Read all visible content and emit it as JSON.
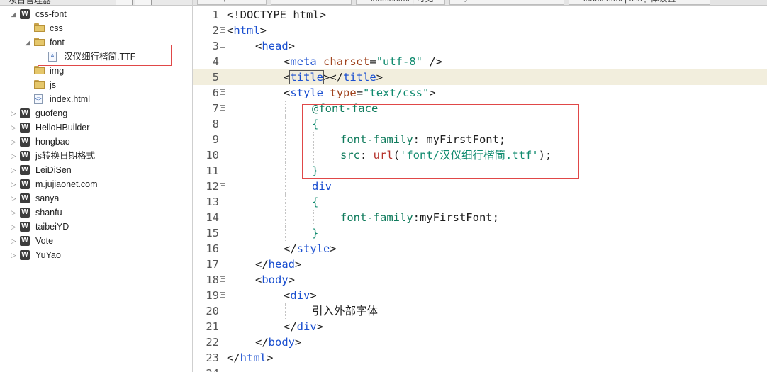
{
  "sidebar": {
    "title": "项目管理器",
    "tree": [
      {
        "depth": 0,
        "expanded": true,
        "icon": "project-icon",
        "label": "css-font"
      },
      {
        "depth": 1,
        "expanded": null,
        "icon": "folder-icon",
        "label": "css"
      },
      {
        "depth": 1,
        "expanded": true,
        "icon": "folder-icon",
        "label": "font"
      },
      {
        "depth": 2,
        "expanded": null,
        "icon": "font-file-icon",
        "label": "汉仪细行楷简.TTF"
      },
      {
        "depth": 1,
        "expanded": null,
        "icon": "folder-icon",
        "label": "img"
      },
      {
        "depth": 1,
        "expanded": null,
        "icon": "folder-icon",
        "label": "js"
      },
      {
        "depth": 1,
        "expanded": null,
        "icon": "html-file-icon",
        "label": "index.html"
      },
      {
        "depth": 0,
        "expanded": false,
        "icon": "project-icon",
        "label": "guofeng"
      },
      {
        "depth": 0,
        "expanded": false,
        "icon": "project-icon",
        "label": "HelloHBuilder"
      },
      {
        "depth": 0,
        "expanded": false,
        "icon": "project-icon",
        "label": "hongbao"
      },
      {
        "depth": 0,
        "expanded": false,
        "icon": "project-icon",
        "label": "js转换日期格式"
      },
      {
        "depth": 0,
        "expanded": false,
        "icon": "project-icon",
        "label": "LeiDiSen"
      },
      {
        "depth": 0,
        "expanded": false,
        "icon": "project-icon",
        "label": "m.jujiaonet.com"
      },
      {
        "depth": 0,
        "expanded": false,
        "icon": "project-icon",
        "label": "sanya"
      },
      {
        "depth": 0,
        "expanded": false,
        "icon": "project-icon",
        "label": "shanfu"
      },
      {
        "depth": 0,
        "expanded": false,
        "icon": "project-icon",
        "label": "taibeiYD"
      },
      {
        "depth": 0,
        "expanded": false,
        "icon": "project-icon",
        "label": "Vote"
      },
      {
        "depth": 0,
        "expanded": false,
        "icon": "project-icon",
        "label": "YuYao"
      }
    ]
  },
  "tabs": [
    "map.html",
    "index.css",
    "index.html | 可见",
    "yuanshemeishi.html",
    "index.html | css字体设置"
  ],
  "editor": {
    "current_line": 5,
    "lines": [
      {
        "n": 1,
        "fold": false,
        "indent": 0,
        "tokens": [
          [
            "punc",
            "<!DOCTYPE html>"
          ]
        ]
      },
      {
        "n": 2,
        "fold": true,
        "indent": 0,
        "tokens": [
          [
            "punc",
            "<"
          ],
          [
            "tag",
            "html"
          ],
          [
            "punc",
            ">"
          ]
        ]
      },
      {
        "n": 3,
        "fold": true,
        "indent": 1,
        "tokens": [
          [
            "punc",
            "<"
          ],
          [
            "tag",
            "head"
          ],
          [
            "punc",
            ">"
          ]
        ]
      },
      {
        "n": 4,
        "fold": false,
        "indent": 2,
        "tokens": [
          [
            "punc",
            "<"
          ],
          [
            "tag",
            "meta"
          ],
          [
            "text",
            " "
          ],
          [
            "attr",
            "charset"
          ],
          [
            "punc",
            "="
          ],
          [
            "str",
            "\"utf-8\""
          ],
          [
            "punc",
            " />"
          ]
        ]
      },
      {
        "n": 5,
        "fold": false,
        "indent": 2,
        "tokens": [
          [
            "punc",
            "<"
          ],
          [
            "tag",
            "title"
          ],
          [
            "punc",
            "></"
          ],
          [
            "tag",
            "title"
          ],
          [
            "punc",
            ">"
          ]
        ]
      },
      {
        "n": 6,
        "fold": true,
        "indent": 2,
        "tokens": [
          [
            "punc",
            "<"
          ],
          [
            "tag",
            "style"
          ],
          [
            "text",
            " "
          ],
          [
            "attr",
            "type"
          ],
          [
            "punc",
            "="
          ],
          [
            "str",
            "\"text/css\""
          ],
          [
            "punc",
            ">"
          ]
        ]
      },
      {
        "n": 7,
        "fold": true,
        "indent": 3,
        "tokens": [
          [
            "at",
            "@font-face"
          ]
        ]
      },
      {
        "n": 8,
        "fold": false,
        "indent": 3,
        "tokens": [
          [
            "str",
            "{"
          ]
        ]
      },
      {
        "n": 9,
        "fold": false,
        "indent": 4,
        "tokens": [
          [
            "prop",
            "font-family"
          ],
          [
            "text",
            ": myFirstFont;"
          ]
        ]
      },
      {
        "n": 10,
        "fold": false,
        "indent": 4,
        "tokens": [
          [
            "prop",
            "src"
          ],
          [
            "text",
            ": "
          ],
          [
            "url",
            "url"
          ],
          [
            "text",
            "("
          ],
          [
            "str",
            "'font/汉仪细行楷简.ttf'"
          ],
          [
            "text",
            ");"
          ]
        ]
      },
      {
        "n": 11,
        "fold": false,
        "indent": 3,
        "tokens": [
          [
            "str",
            "}"
          ]
        ]
      },
      {
        "n": 12,
        "fold": true,
        "indent": 3,
        "tokens": [
          [
            "tag",
            "div"
          ]
        ]
      },
      {
        "n": 13,
        "fold": false,
        "indent": 3,
        "tokens": [
          [
            "str",
            "{"
          ]
        ]
      },
      {
        "n": 14,
        "fold": false,
        "indent": 4,
        "tokens": [
          [
            "prop",
            "font-family"
          ],
          [
            "text",
            ":myFirstFont;"
          ]
        ]
      },
      {
        "n": 15,
        "fold": false,
        "indent": 3,
        "tokens": [
          [
            "str",
            "}"
          ]
        ]
      },
      {
        "n": 16,
        "fold": false,
        "indent": 2,
        "tokens": [
          [
            "punc",
            "</"
          ],
          [
            "tag",
            "style"
          ],
          [
            "punc",
            ">"
          ]
        ]
      },
      {
        "n": 17,
        "fold": false,
        "indent": 1,
        "tokens": [
          [
            "punc",
            "</"
          ],
          [
            "tag",
            "head"
          ],
          [
            "punc",
            ">"
          ]
        ]
      },
      {
        "n": 18,
        "fold": true,
        "indent": 1,
        "tokens": [
          [
            "punc",
            "<"
          ],
          [
            "tag",
            "body"
          ],
          [
            "punc",
            ">"
          ]
        ]
      },
      {
        "n": 19,
        "fold": true,
        "indent": 2,
        "tokens": [
          [
            "punc",
            "<"
          ],
          [
            "tag",
            "div"
          ],
          [
            "punc",
            ">"
          ]
        ]
      },
      {
        "n": 20,
        "fold": false,
        "indent": 3,
        "tokens": [
          [
            "text",
            "引入外部字体"
          ]
        ]
      },
      {
        "n": 21,
        "fold": false,
        "indent": 2,
        "tokens": [
          [
            "punc",
            "</"
          ],
          [
            "tag",
            "div"
          ],
          [
            "punc",
            ">"
          ]
        ]
      },
      {
        "n": 22,
        "fold": false,
        "indent": 1,
        "tokens": [
          [
            "punc",
            "</"
          ],
          [
            "tag",
            "body"
          ],
          [
            "punc",
            ">"
          ]
        ]
      },
      {
        "n": 23,
        "fold": false,
        "indent": 0,
        "tokens": [
          [
            "punc",
            "</"
          ],
          [
            "tag",
            "html"
          ],
          [
            "punc",
            ">"
          ]
        ]
      },
      {
        "n": 24,
        "fold": false,
        "indent": 0,
        "tokens": []
      }
    ]
  },
  "colors": {
    "highlight_box": "#e04848",
    "current_line_bg": "#f2eedd",
    "tag": "#1a4fd0",
    "attribute": "#a0431e",
    "string": "#0f8a6e"
  }
}
